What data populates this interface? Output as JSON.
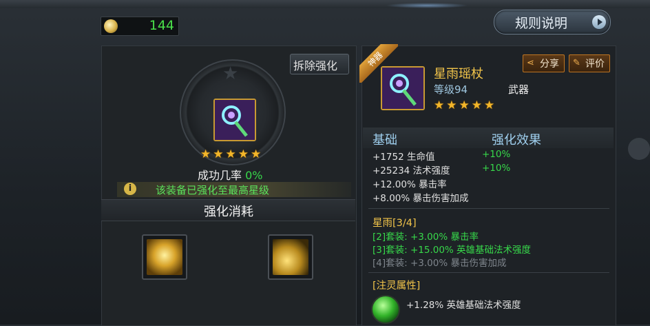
{
  "currency": {
    "icon": "gold-orb-icon",
    "value": "144"
  },
  "rules_button": {
    "label": "规则说明"
  },
  "left": {
    "remove_button": "拆除强化",
    "stars": 5,
    "success_label": "成功几率",
    "success_value": "0%",
    "maxed_notice": "该装备已强化至最高星级",
    "cost_title": "强化消耗",
    "materials": [
      {
        "icon": "enhance-stone-icon"
      },
      {
        "icon": "gold-coins-icon"
      }
    ]
  },
  "right": {
    "ribbon": "神器",
    "item_name": "星雨瑶杖",
    "item_level": "等级94",
    "item_type": "武器",
    "stars": 5,
    "share_label": "分享",
    "rate_label": "评价",
    "base_header": "基础",
    "effect_header": "强化效果",
    "stats": [
      {
        "text": "+1752 生命值",
        "bonus": "+10%"
      },
      {
        "text": "+25234 法术强度",
        "bonus": "+10%"
      },
      {
        "text": "+12.00% 暴击率",
        "bonus": ""
      },
      {
        "text": "+8.00% 暴击伤害加成",
        "bonus": ""
      }
    ],
    "set_title": "星雨[3/4]",
    "set_lines": [
      {
        "text": "[2]套装: +3.00% 暴击率",
        "active": true
      },
      {
        "text": "[3]套装: +15.00% 英雄基础法术强度",
        "active": true
      },
      {
        "text": "[4]套装: +3.00% 暴击伤害加成",
        "active": false
      }
    ],
    "infuse_title": "[注灵属性]",
    "infuse_line": "+1.28% 英雄基础法术强度"
  },
  "colors": {
    "gold_text": "#f3c54a",
    "green_text": "#37d84a",
    "blue_text": "#9fcfee",
    "inactive": "#7e858c"
  }
}
